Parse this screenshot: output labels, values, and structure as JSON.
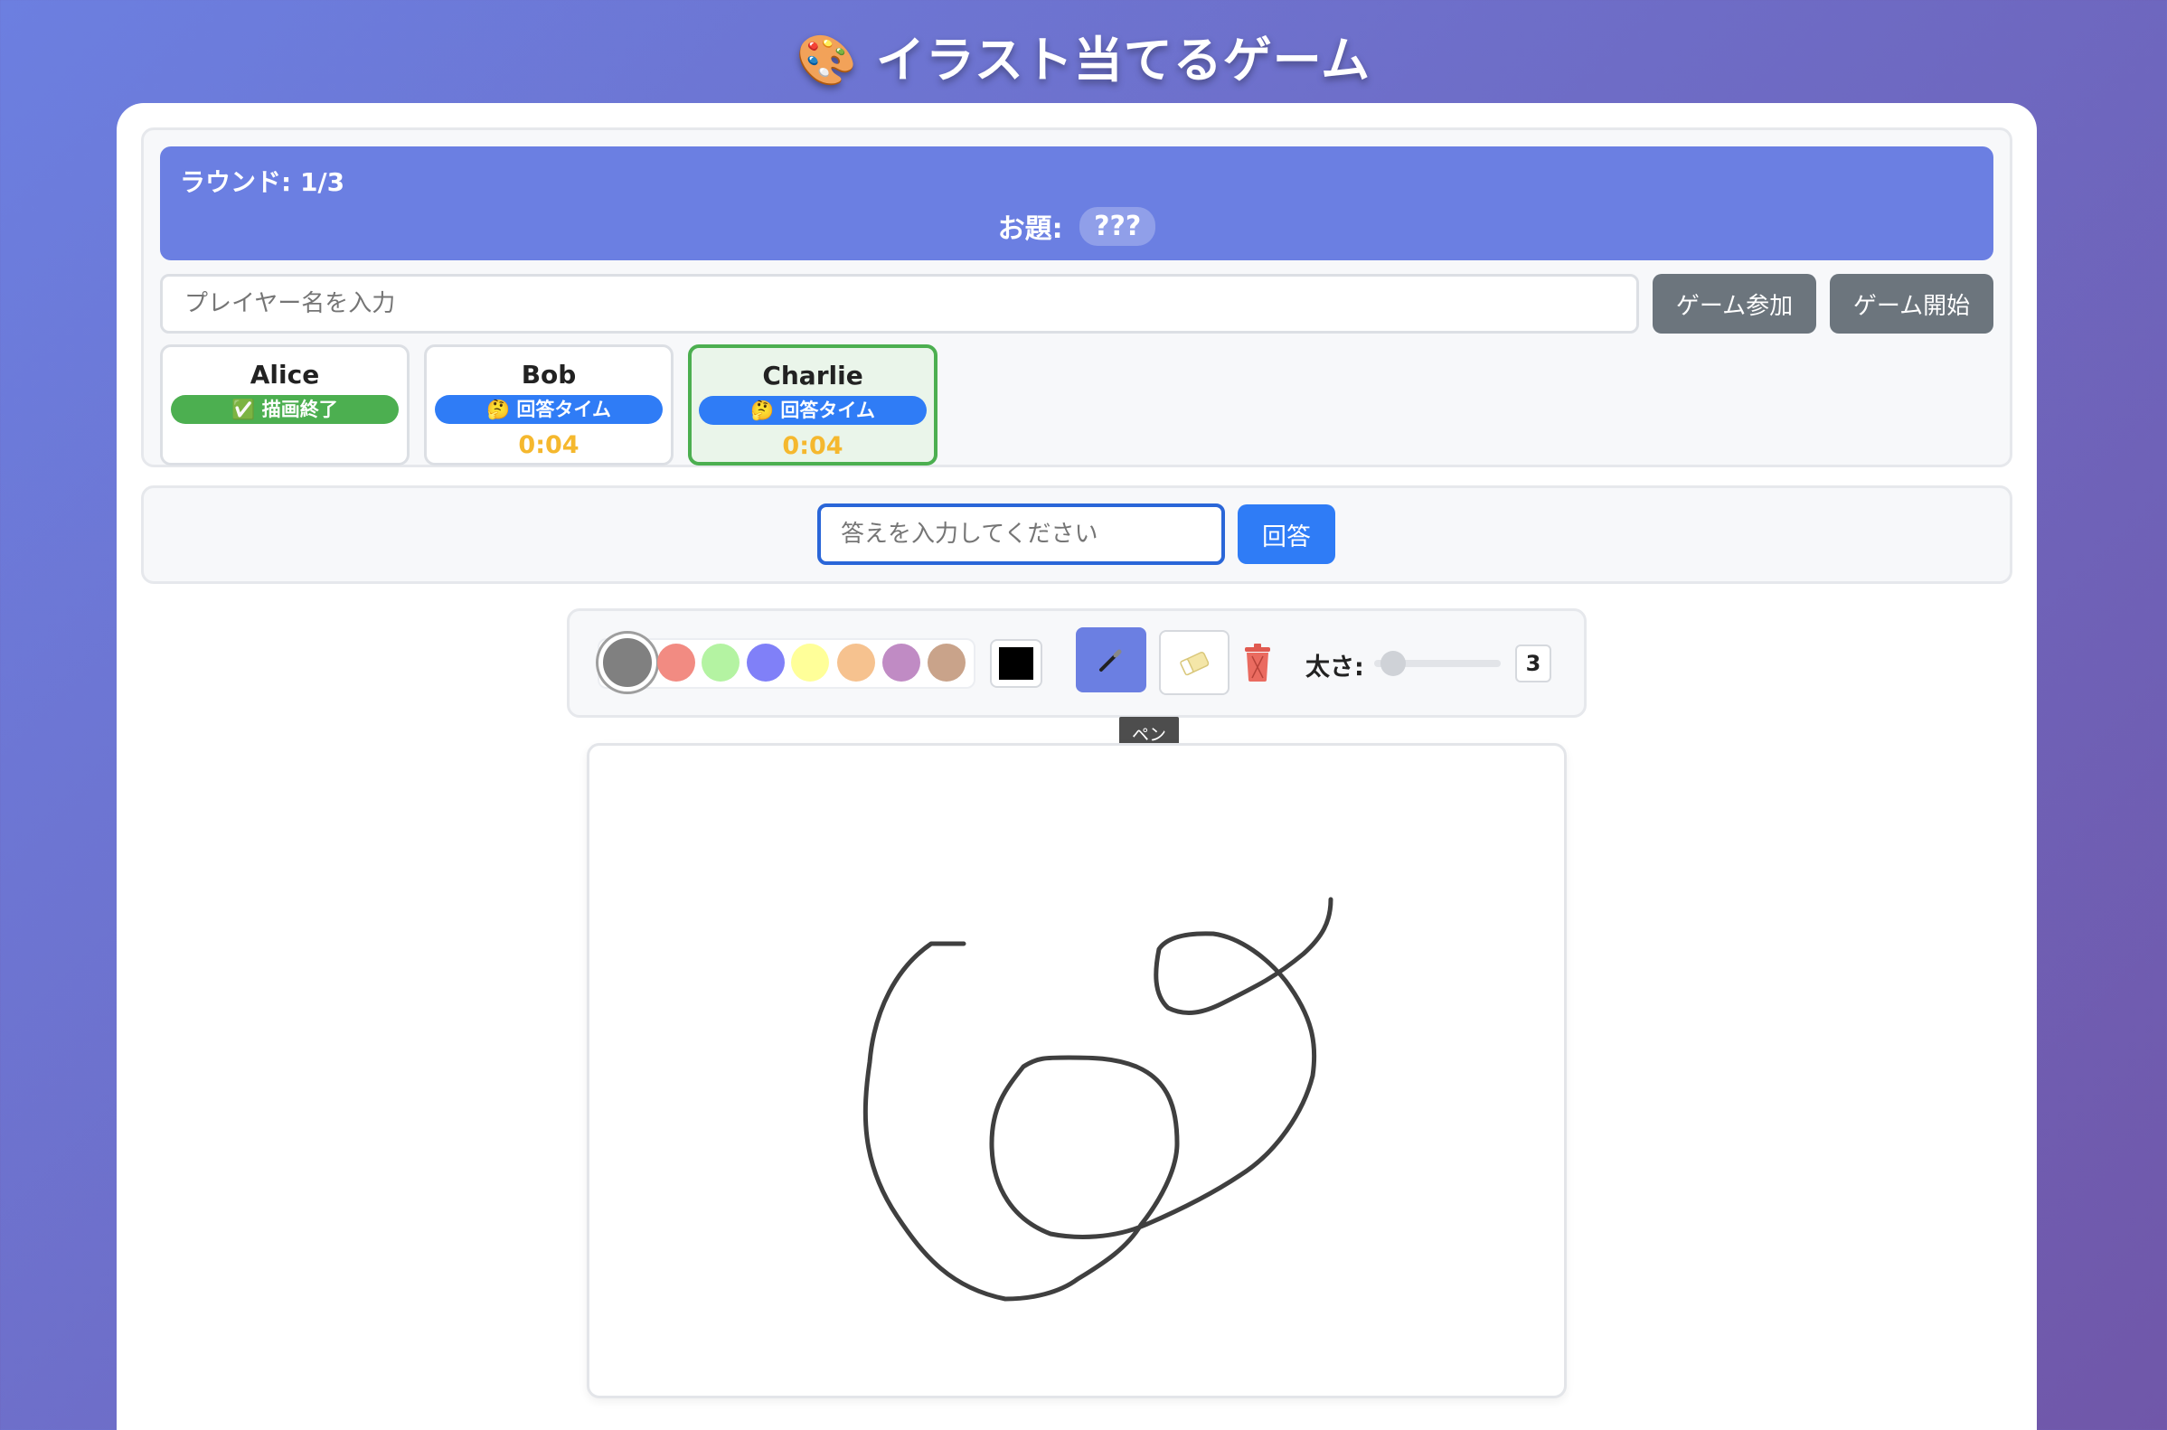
{
  "app": {
    "title": "🎨 イラスト当てるゲーム"
  },
  "round": {
    "label": "ラウンド: 1/3",
    "topic_label": "お題:",
    "topic_value": "???"
  },
  "join": {
    "name_placeholder": "プレイヤー名を入力",
    "join_label": "ゲーム参加",
    "start_label": "ゲーム開始"
  },
  "players": [
    {
      "name": "Alice",
      "status": "✅ 描画終了",
      "timer": ""
    },
    {
      "name": "Bob",
      "status": "🤔 回答タイム",
      "timer": "0:04"
    },
    {
      "name": "Charlie",
      "status": "🤔 回答タイム",
      "timer": "0:04"
    }
  ],
  "answer": {
    "placeholder": "答えを入力してください",
    "submit_label": "回答"
  },
  "toolbar": {
    "colors": [
      "#808080",
      "#f28b82",
      "#b4f3a2",
      "#8080f8",
      "#ffff99",
      "#f6c28f",
      "#c08bc4",
      "#c9a38a"
    ],
    "selected_color": "#808080",
    "custom_color": "#000000",
    "size_label": "太さ:",
    "size_value": "3",
    "pen_tooltip": "ペン"
  }
}
